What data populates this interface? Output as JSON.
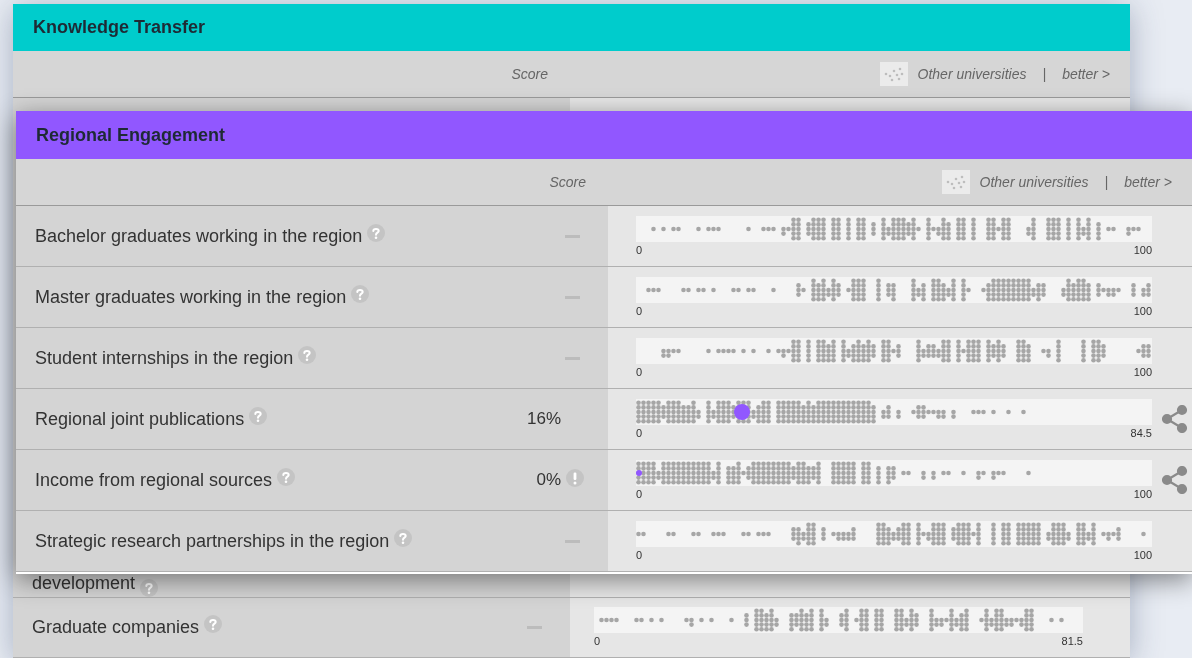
{
  "cards": [
    {
      "title": "Knowledge Transfer",
      "color": "#00cccc",
      "score_heading": "Score",
      "legend": "Other universities",
      "separator": "|",
      "better": "better >",
      "rows": [
        {
          "kind": "partial",
          "label": "development",
          "help": true
        },
        {
          "kind": "no_score",
          "label": "Graduate companies",
          "help": true,
          "axis_min": "0",
          "axis_max": "81.5"
        }
      ]
    },
    {
      "title": "Regional Engagement",
      "color": "#9157ff",
      "score_heading": "Score",
      "legend": "Other universities",
      "separator": "|",
      "better": "better >",
      "rows": [
        {
          "kind": "no_score",
          "label": "Bachelor graduates working in the region",
          "help": true,
          "axis_min": "0",
          "axis_max": "100"
        },
        {
          "kind": "no_score",
          "label": "Master graduates working in the region",
          "help": true,
          "axis_min": "0",
          "axis_max": "100"
        },
        {
          "kind": "no_score",
          "label": "Student internships in the region",
          "help": true,
          "axis_min": "0",
          "axis_max": "100"
        },
        {
          "kind": "score",
          "label": "Regional joint publications",
          "help": true,
          "score": "16%",
          "warning": false,
          "level": 0.19,
          "share": true,
          "axis_min": "0",
          "axis_max": "84.5"
        },
        {
          "kind": "score",
          "label": "Income from regional sources",
          "help": true,
          "score": "0%",
          "warning": true,
          "level": 0.0,
          "share": true,
          "axis_min": "0",
          "axis_max": "100"
        },
        {
          "kind": "no_score",
          "label": "Strategic research partnerships in the region",
          "help": true,
          "axis_min": "0",
          "axis_max": "100"
        }
      ]
    }
  ]
}
